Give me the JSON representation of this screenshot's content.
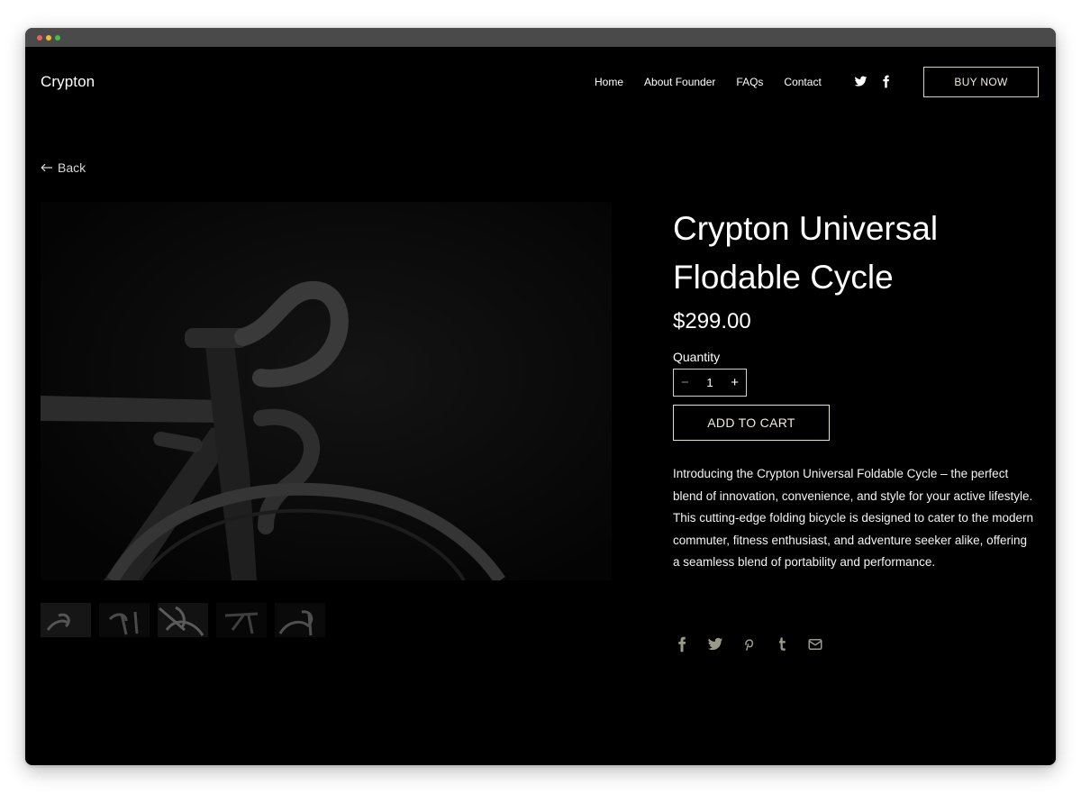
{
  "brand": "Crypton",
  "nav": [
    {
      "label": "Home"
    },
    {
      "label": "About Founder"
    },
    {
      "label": "FAQs"
    },
    {
      "label": "Contact"
    }
  ],
  "header": {
    "buy_now_label": "BUY NOW",
    "social_icons": [
      "twitter-icon",
      "facebook-icon"
    ]
  },
  "back_label": "Back",
  "product": {
    "title": "Crypton Universal Flodable Cycle",
    "price": "$299.00",
    "quantity_label": "Quantity",
    "quantity_value": "1",
    "add_to_cart_label": "ADD TO CART",
    "description": "Introducing the Crypton Universal Foldable Cycle – the perfect blend of innovation, convenience, and style for your active lifestyle. This cutting-edge folding bicycle is designed to cater to the modern commuter, fitness enthusiast, and adventure seeker alike, offering a seamless blend of portability and performance.",
    "thumbnail_count": 5,
    "share_icons": [
      "facebook-icon",
      "twitter-icon",
      "pinterest-icon",
      "tumblr-icon",
      "email-icon"
    ]
  },
  "colors": {
    "background": "#000000",
    "accent_border": "#e6e2cc",
    "share_icon": "#9a9a8a",
    "window_bar": "#4a4a4a"
  }
}
